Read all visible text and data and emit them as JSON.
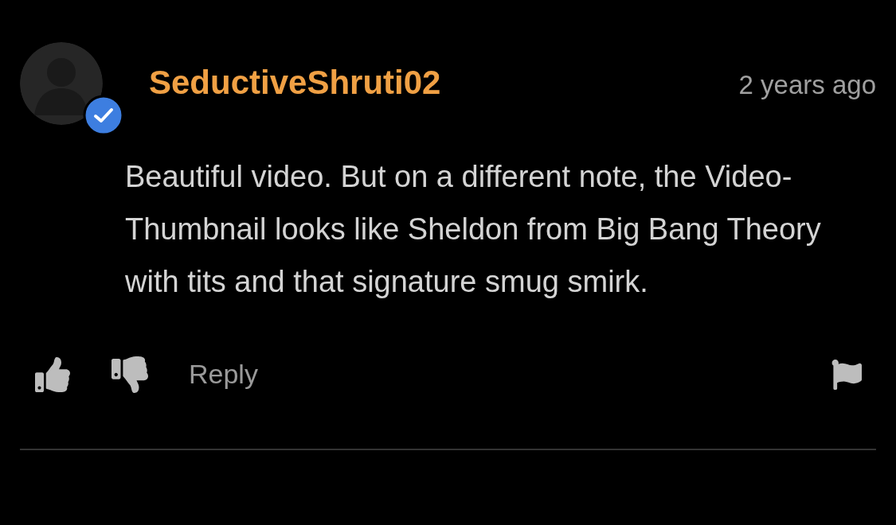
{
  "comment": {
    "username": "SeductiveShruti02",
    "verified": true,
    "time": "2 years ago",
    "text": "Beautiful video. But on a different note, the Video-Thumbnail looks like Sheldon from Big Bang Theory with tits and that signature smug smirk.",
    "actions": {
      "reply": "Reply"
    }
  }
}
